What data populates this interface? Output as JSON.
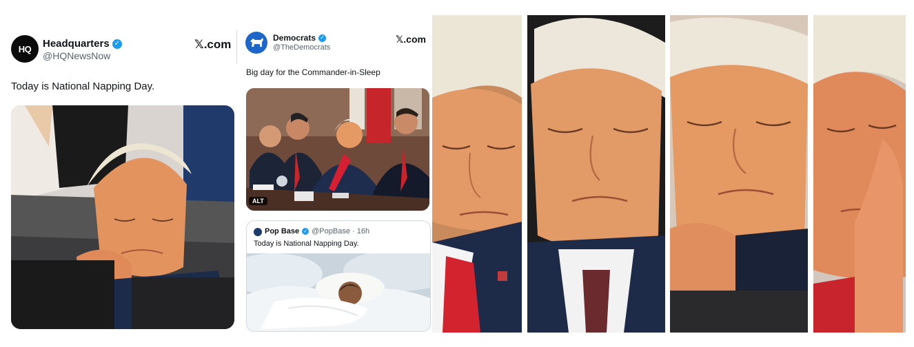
{
  "tweet1": {
    "avatar_text": "HQ",
    "name": "Headquarters",
    "handle": "@HQNewsNow",
    "source": "𝕏.com",
    "text": "Today is National Napping Day.",
    "image_icon": "photo-sleeping-man-hand-on-chin"
  },
  "tweet2": {
    "name": "Democrats",
    "handle": "@TheDemocrats",
    "source": "𝕏.com",
    "text": "Big day for the Commander-in-Sleep",
    "image_icon": "photo-cabinet-meeting",
    "alt_badge": "ALT",
    "quote": {
      "name": "Pop Base",
      "handle": "@PopBase · 16h",
      "text": "Today is National Napping Day.",
      "image_icon": "photo-person-sleeping-in-bed-on-clouds"
    }
  },
  "collage": {
    "panels": [
      "sleeping-man-closeup-red-tie",
      "sleeping-man-head-tilted",
      "sleeping-man-hand-on-chin",
      "sleeping-man-hand-on-face"
    ]
  },
  "colors": {
    "verified": "#1d9bf0",
    "handle_gray": "#536471",
    "democrats_blue": "#1f66c9",
    "skin": "#e0955f",
    "hair": "#ece5d2",
    "suit": "#1c2b4a",
    "tie": "#d1242f"
  }
}
